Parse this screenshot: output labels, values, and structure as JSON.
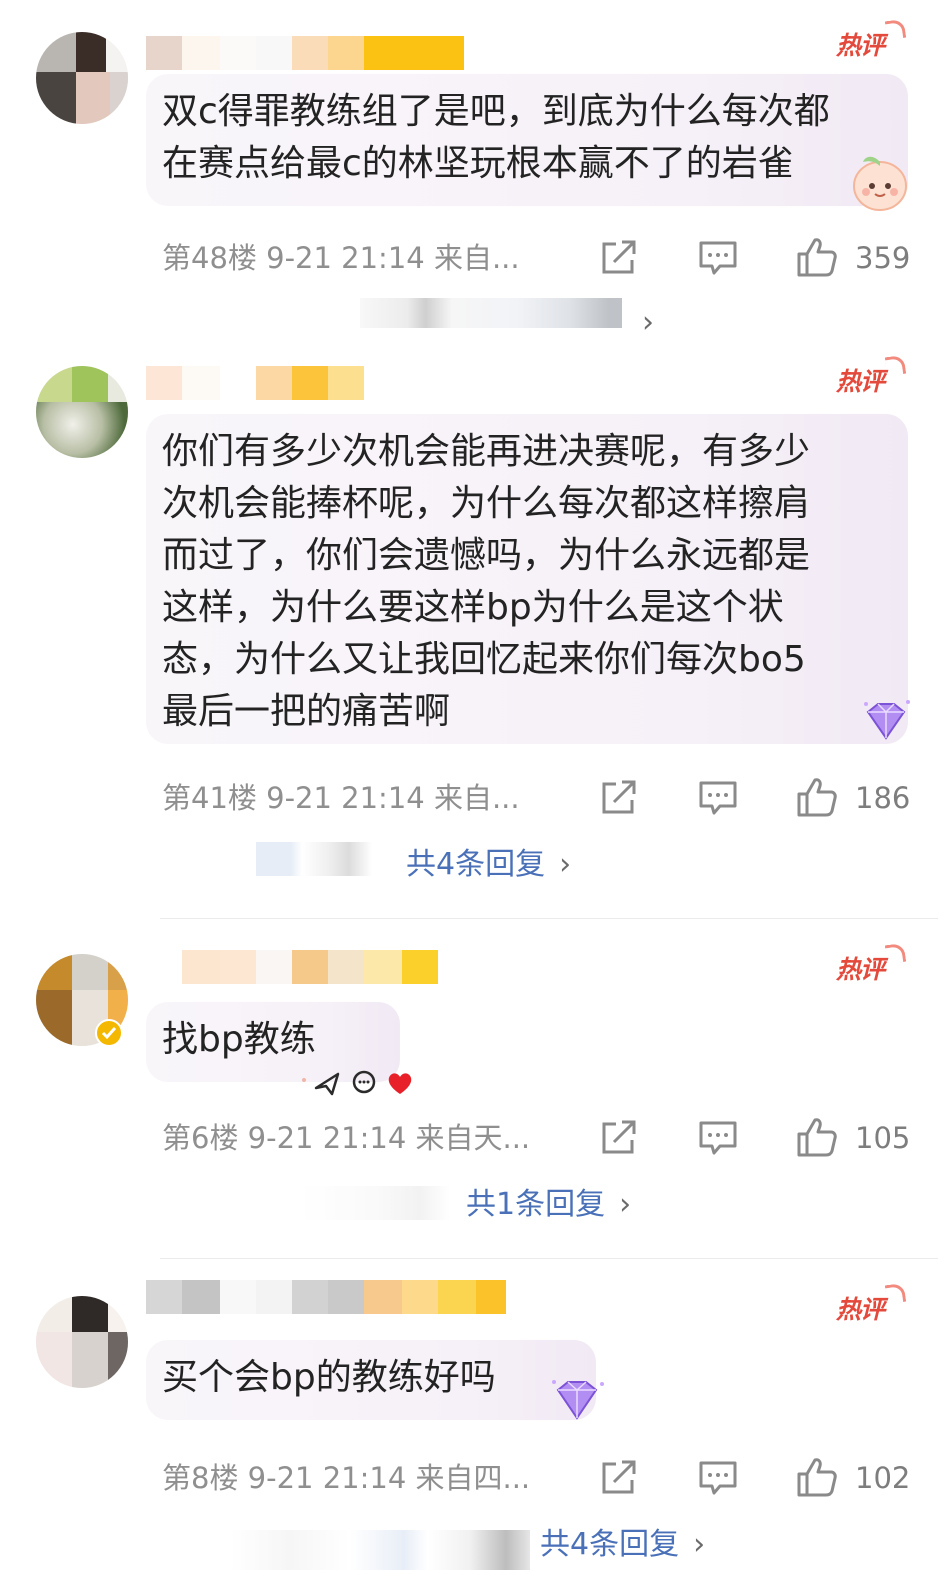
{
  "hot_label": "热评",
  "comments": [
    {
      "text": "双c得罪教练组了是吧，到底为什么每次都\n在赛点给最c的林坚玩根本赢不了的岩雀",
      "meta": "第48楼 9-21 21:14 来自...",
      "likes": "359",
      "replies": ""
    },
    {
      "text": "你们有多少次机会能再进决赛呢，有多少\n次机会能捧杯呢，为什么每次都这样擦肩\n而过了，你们会遗憾吗，为什么永远都是\n这样，为什么要这样bp为什么是这个状\n态，为什么又让我回忆起来你们每次bo5\n最后一把的痛苦啊",
      "meta": "第41楼 9-21 21:14 来自...",
      "likes": "186",
      "replies": "共4条回复"
    },
    {
      "text": "找bp教练",
      "meta": "第6楼 9-21 21:14 来自天...",
      "likes": "105",
      "replies": "共1条回复"
    },
    {
      "text": "买个会bp的教练好吗",
      "meta": "第8楼 9-21 21:14 来自四...",
      "likes": "102",
      "replies": "共4条回复"
    }
  ],
  "chevron": "›",
  "icons": {
    "share": "share-icon",
    "comment": "comment-icon",
    "like": "thumbs-up-icon",
    "verified": "verified-badge-icon",
    "badge": "diamond-badge-icon"
  }
}
